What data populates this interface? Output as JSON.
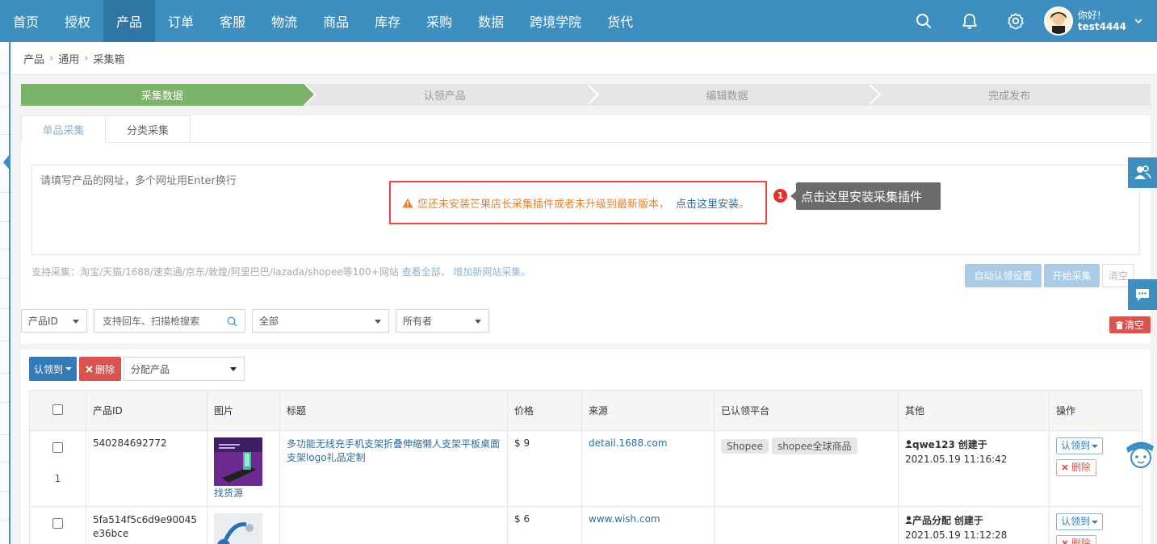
{
  "nav": {
    "items": [
      "首页",
      "授权",
      "产品",
      "订单",
      "客服",
      "物流",
      "商品",
      "库存",
      "采购",
      "数据",
      "跨境学院",
      "货代"
    ],
    "active_index": 2,
    "user": {
      "greeting": "你好!",
      "name": "test4444"
    }
  },
  "breadcrumb": [
    "产品",
    "通用",
    "采集箱"
  ],
  "steps": [
    "采集数据",
    "认领产品",
    "编辑数据",
    "完成发布"
  ],
  "tabs": [
    "单品采集",
    "分类采集"
  ],
  "url_input": {
    "placeholder": "请填写产品的网址，多个网址用Enter换行"
  },
  "warning": {
    "text": "您还未安装芒果店长采集插件或者未升级到最新版本，",
    "link": "点击这里安装",
    "end": "。"
  },
  "callout": {
    "number": "1",
    "text": "点击这里安装采集插件"
  },
  "support": {
    "text": "支持采集：淘宝/天猫/1688/速卖通/京东/敦煌/阿里巴巴/lazada/shopee等100+网站",
    "view_all": "查看全部",
    "add_site": "增加新网站采集",
    "end": "。"
  },
  "actions": {
    "auto_claim": "自动认领设置",
    "start": "开始采集",
    "clear": "清空"
  },
  "filters": {
    "field_select": "产品ID",
    "search_placeholder": "支持回车、扫描枪搜索",
    "status_select": "全部",
    "owner_select": "所有者",
    "clear_button": "清空"
  },
  "toolbar": {
    "claim": "认领到",
    "delete": "删除",
    "assign": "分配产品"
  },
  "table": {
    "headers": [
      "产品ID",
      "图片",
      "标题",
      "价格",
      "来源",
      "已认领平台",
      "其他",
      "操作"
    ],
    "rows": [
      {
        "index": "1",
        "id": "540284692772",
        "find_source": "找货源",
        "title": "多功能无线充手机支架折叠伸缩懒人支架平板桌面支架logo礼品定制",
        "price": "$ 9",
        "source": "detail.1688.com",
        "platforms": [
          "Shopee",
          "shopee全球商品"
        ],
        "creator": "qwe123",
        "created_label": "创建于",
        "created_at": "2021.05.19 11:16:42",
        "claim": "认领到",
        "delete": "删除"
      },
      {
        "index": "",
        "id": "5fa514f5c6d9e90045e36bce",
        "find_source": "",
        "title": "",
        "price": "$ 6",
        "source": "www.wish.com",
        "platforms": [],
        "creator": "产品分配",
        "created_label": "创建于",
        "created_at": "2021.05.19 11:12:28",
        "claim": "认领到",
        "delete": "删除"
      }
    ]
  },
  "colors": {
    "nav": "#3e8ec0",
    "nav_active": "#2f76a6",
    "step_active": "#7cb36b",
    "danger": "#d9534f",
    "primary": "#337ab7",
    "warning_text": "#e5822d"
  }
}
